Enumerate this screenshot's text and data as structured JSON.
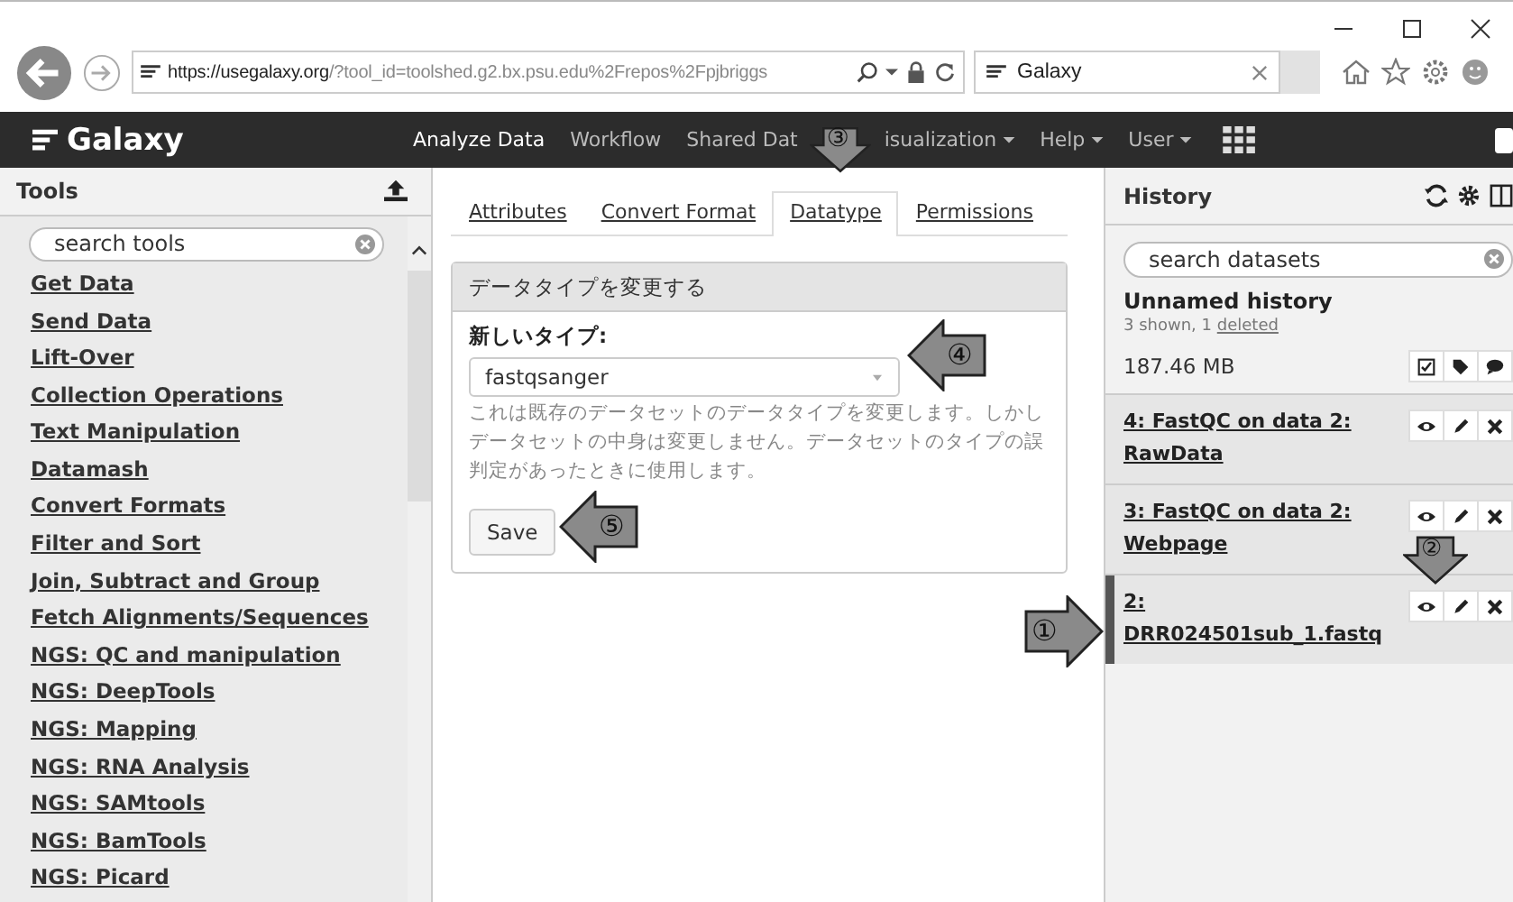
{
  "browser": {
    "url_host": "https://usegalaxy.org",
    "url_path": "/?tool_id=toolshed.g2.bx.psu.edu%2Frepos%2Fpjbriggs",
    "tab_title": "Galaxy"
  },
  "masthead": {
    "brand": "Galaxy",
    "nav": [
      {
        "label": "Analyze Data",
        "selected": true,
        "dropdown": false
      },
      {
        "label": "Workflow",
        "selected": false,
        "dropdown": false
      },
      {
        "label": "Shared Dat",
        "selected": false,
        "dropdown": false
      },
      {
        "label": "isualization",
        "selected": false,
        "dropdown": true
      },
      {
        "label": "Help",
        "selected": false,
        "dropdown": true
      },
      {
        "label": "User",
        "selected": false,
        "dropdown": true
      }
    ]
  },
  "tools": {
    "title": "Tools",
    "search": {
      "placeholder": "search tools"
    },
    "items": [
      "Get Data",
      "Send Data",
      "Lift-Over",
      "Collection Operations",
      "Text Manipulation",
      "Datamash",
      "Convert Formats",
      "Filter and Sort",
      "Join, Subtract and Group",
      "Fetch Alignments/Sequences",
      "NGS: QC and manipulation",
      "NGS: DeepTools",
      "NGS: Mapping",
      "NGS: RNA Analysis",
      "NGS: SAMtools",
      "NGS: BamTools",
      "NGS: Picard"
    ]
  },
  "center": {
    "tabs": [
      {
        "label": "Attributes",
        "selected": false
      },
      {
        "label": "Convert Format",
        "selected": false
      },
      {
        "label": "Datatype",
        "selected": true
      },
      {
        "label": "Permissions",
        "selected": false
      }
    ],
    "panel": {
      "title": "データタイプを変更する",
      "field_label": "新しいタイプ:",
      "select_value": "fastqsanger",
      "help": "これは既存のデータセットのデータタイプを変更します。しかしデータセットの中身は変更しません。データセットのタイプの誤判定があったときに使用します。",
      "button": "Save"
    }
  },
  "history": {
    "title": "History",
    "search": {
      "placeholder": "search datasets"
    },
    "name": "Unnamed history",
    "summary": "3 shown, 1 ",
    "deleted_link": "deleted",
    "size": "187.46 MB",
    "datasets": [
      {
        "title": "4: FastQC on data 2: RawData",
        "current": false
      },
      {
        "title": "3: FastQC on data 2: Webpage",
        "current": false
      },
      {
        "title": "2: DRR024501sub_1.fastq",
        "current": true
      }
    ]
  },
  "callouts": [
    {
      "number": "①",
      "kind": "right"
    },
    {
      "number": "②",
      "kind": "down"
    },
    {
      "number": "③",
      "kind": "down"
    },
    {
      "number": "④",
      "kind": "left"
    },
    {
      "number": "⑤",
      "kind": "left"
    }
  ]
}
